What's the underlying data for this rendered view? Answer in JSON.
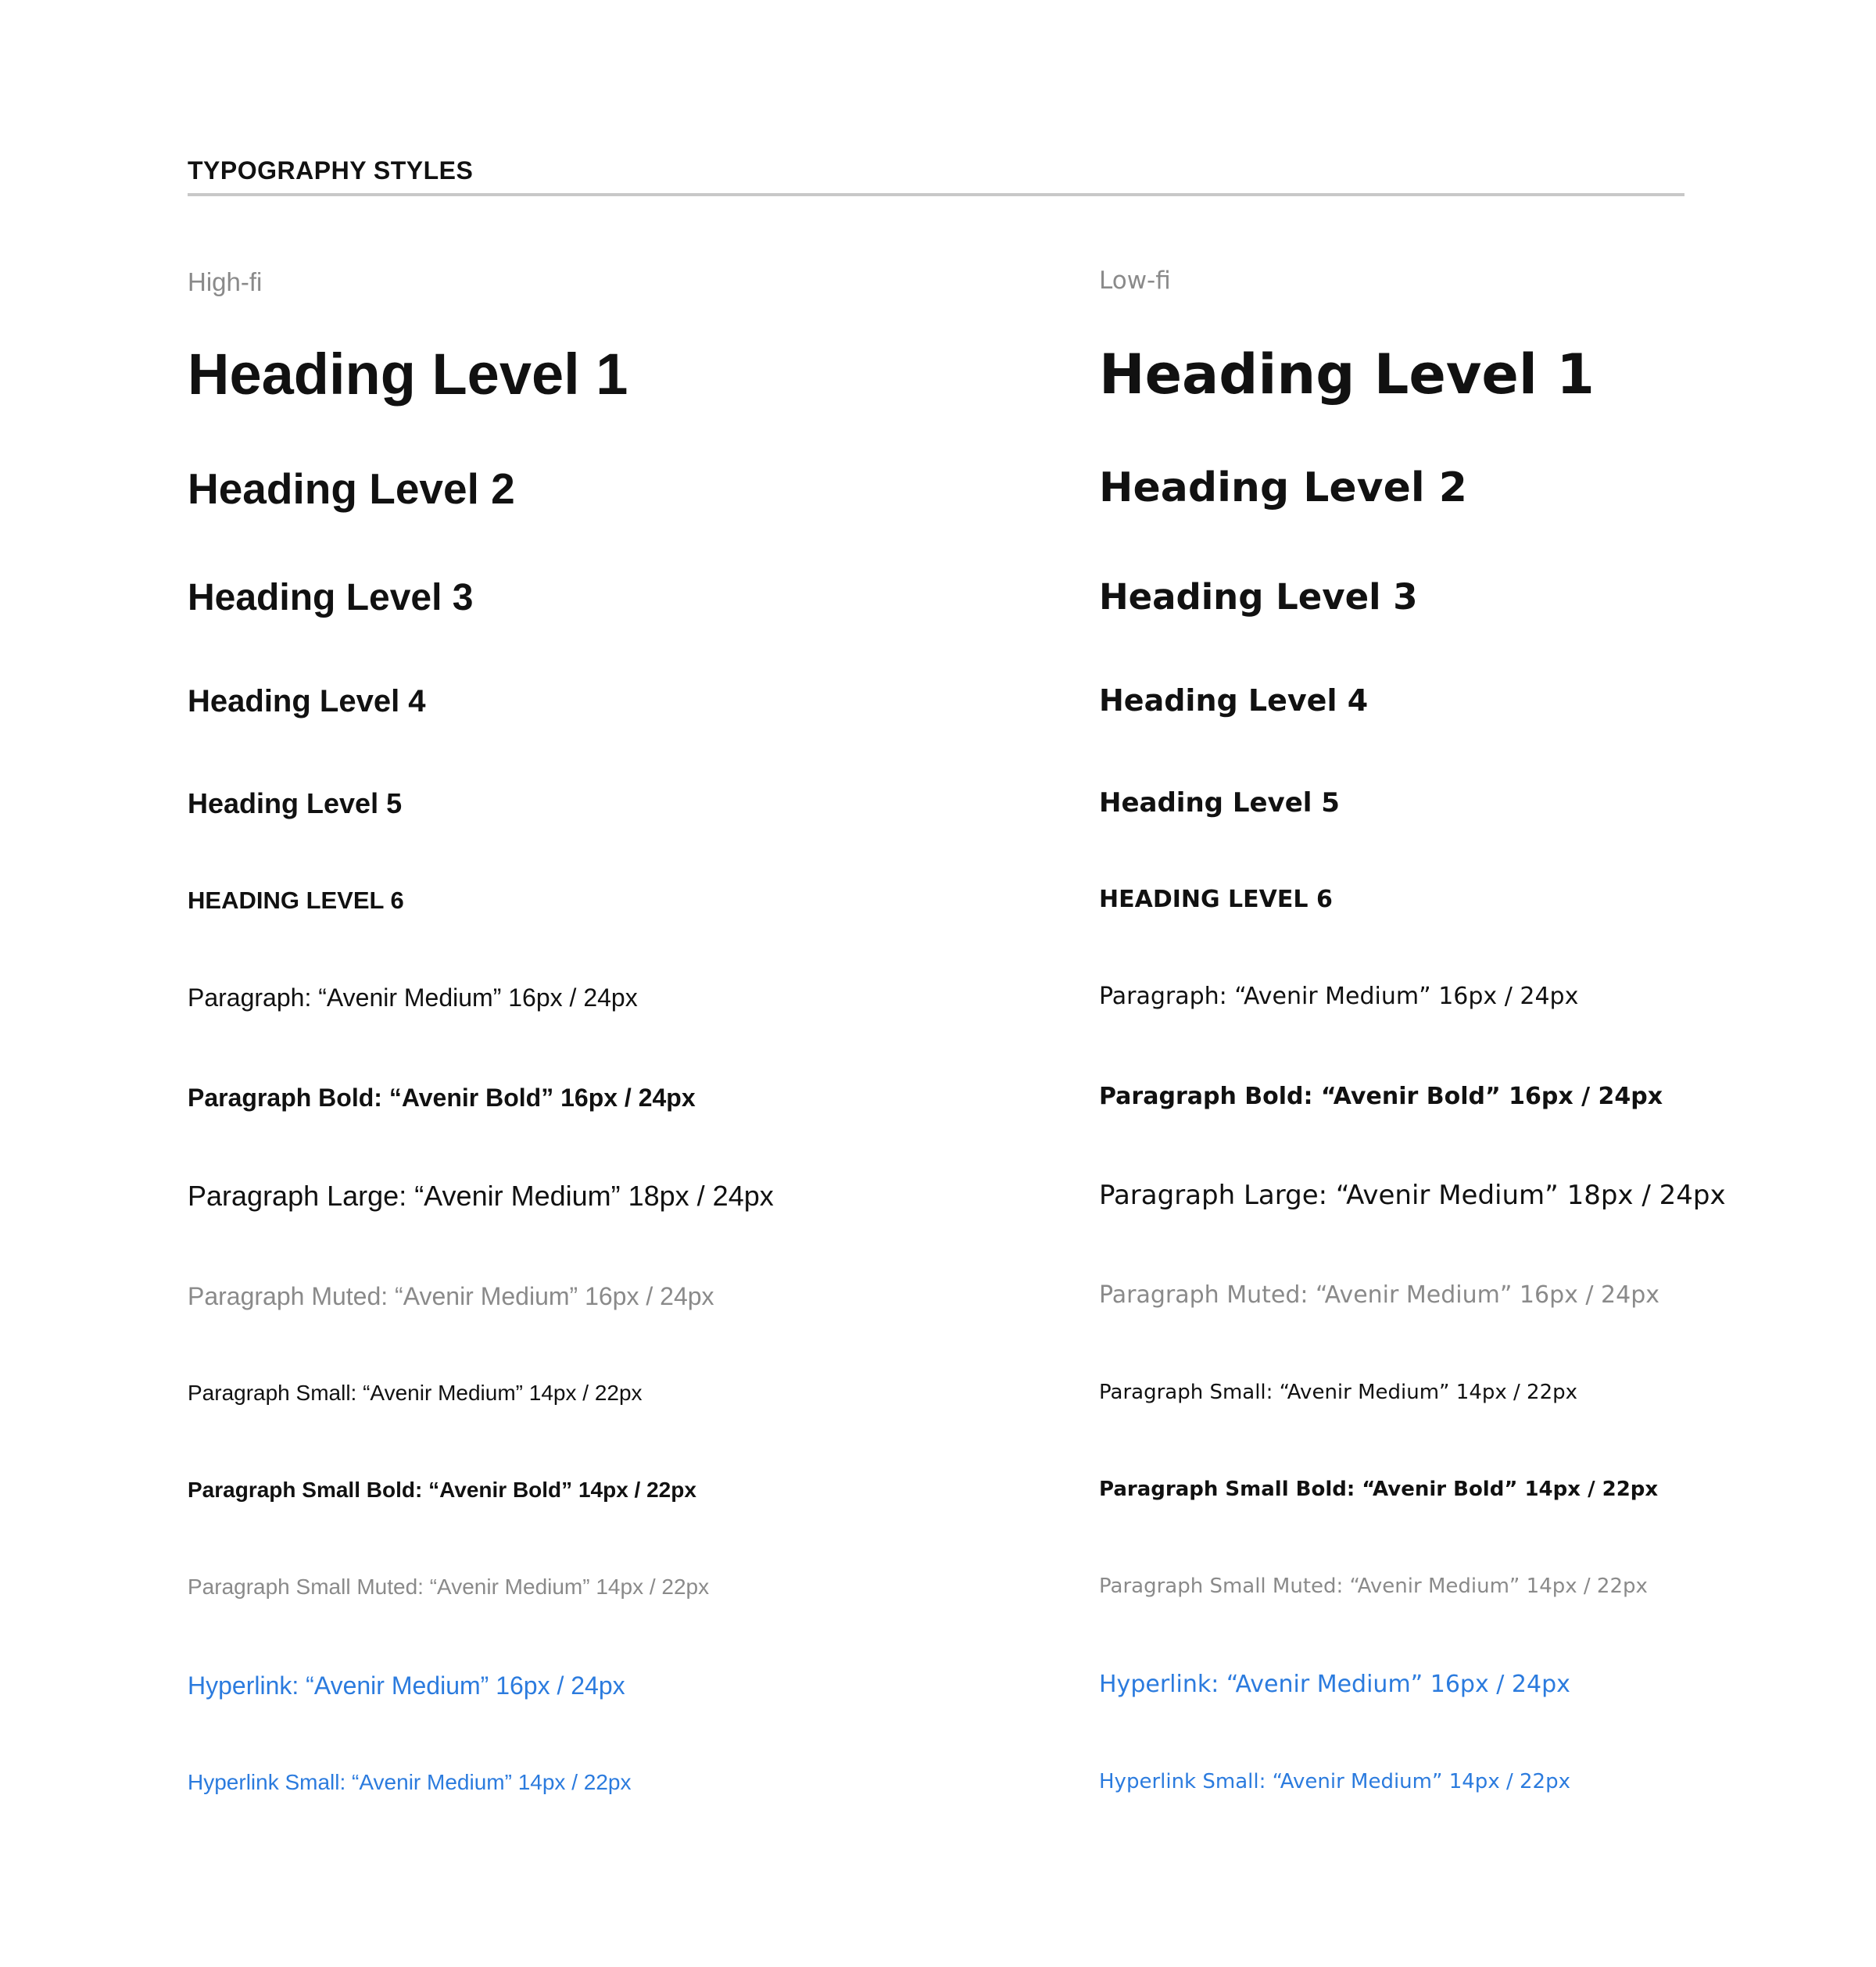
{
  "header": {
    "title": "TYPOGRAPHY STYLES"
  },
  "columns": {
    "high_fi": {
      "label": "High-fi",
      "h1": "Heading Level 1",
      "h2": "Heading Level 2",
      "h3": "Heading Level 3",
      "h4": "Heading Level 4",
      "h5": "Heading Level 5",
      "h6": "HEADING LEVEL 6",
      "paragraph": "Paragraph: “Avenir Medium” 16px / 24px",
      "paragraph_bold": "Paragraph Bold: “Avenir Bold” 16px / 24px",
      "paragraph_large": "Paragraph Large: “Avenir Medium” 18px / 24px",
      "paragraph_muted": "Paragraph Muted: “Avenir Medium” 16px / 24px",
      "paragraph_small": "Paragraph Small: “Avenir Medium” 14px / 22px",
      "paragraph_small_bold": "Paragraph Small Bold: “Avenir Bold” 14px / 22px",
      "paragraph_small_muted": "Paragraph Small Muted: “Avenir Medium” 14px / 22px",
      "hyperlink": "Hyperlink: “Avenir Medium” 16px / 24px",
      "hyperlink_small": "Hyperlink Small: “Avenir Medium” 14px / 22px"
    },
    "low_fi": {
      "label": "Low-fi",
      "h1": "Heading Level 1",
      "h2": "Heading Level 2",
      "h3": "Heading Level 3",
      "h4": "Heading Level 4",
      "h5": "Heading Level 5",
      "h6": "HEADING LEVEL 6",
      "paragraph": "Paragraph: “Avenir Medium” 16px / 24px",
      "paragraph_bold": "Paragraph Bold: “Avenir Bold” 16px / 24px",
      "paragraph_large": "Paragraph Large: “Avenir Medium” 18px / 24px",
      "paragraph_muted": "Paragraph Muted: “Avenir Medium” 16px / 24px",
      "paragraph_small": "Paragraph Small: “Avenir Medium” 14px / 22px",
      "paragraph_small_bold": "Paragraph Small Bold: “Avenir Bold” 14px / 22px",
      "paragraph_small_muted": "Paragraph Small Muted: “Avenir Medium” 14px / 22px",
      "hyperlink": "Hyperlink: “Avenir Medium” 16px / 24px",
      "hyperlink_small": "Hyperlink Small: “Avenir Medium” 14px / 22px"
    }
  },
  "colors": {
    "text": "#111111",
    "muted": "#8a8a8a",
    "link": "#2b7bde",
    "rule": "#c8c8c8"
  }
}
